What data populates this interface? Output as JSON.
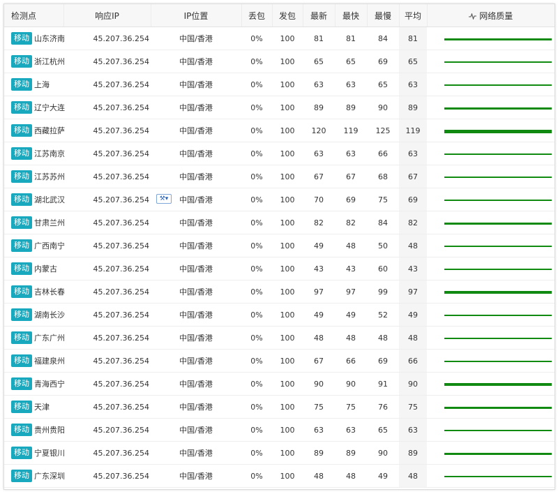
{
  "headers": {
    "node": "检测点",
    "ip": "响应IP",
    "location": "IP位置",
    "loss": "丢包",
    "sent": "发包",
    "latest": "最新",
    "fastest": "最快",
    "slowest": "最慢",
    "avg": "平均",
    "quality": "网络质量"
  },
  "icons": {
    "quality_header": "pulse-icon",
    "tool": "wrench-dropdown-icon"
  },
  "colors": {
    "isp_badge": "#19a9be",
    "quality_line": "#118a11"
  },
  "rows": [
    {
      "isp": "移动",
      "city": "山东济南",
      "ip": "45.207.36.254",
      "location": "中国/香港",
      "loss": "0%",
      "sent": "100",
      "latest": "81",
      "fastest": "81",
      "slowest": "84",
      "avg": "81"
    },
    {
      "isp": "移动",
      "city": "浙江杭州",
      "ip": "45.207.36.254",
      "location": "中国/香港",
      "loss": "0%",
      "sent": "100",
      "latest": "65",
      "fastest": "65",
      "slowest": "69",
      "avg": "65"
    },
    {
      "isp": "移动",
      "city": "上海",
      "ip": "45.207.36.254",
      "location": "中国/香港",
      "loss": "0%",
      "sent": "100",
      "latest": "63",
      "fastest": "63",
      "slowest": "65",
      "avg": "63"
    },
    {
      "isp": "移动",
      "city": "辽宁大连",
      "ip": "45.207.36.254",
      "location": "中国/香港",
      "loss": "0%",
      "sent": "100",
      "latest": "89",
      "fastest": "89",
      "slowest": "90",
      "avg": "89"
    },
    {
      "isp": "移动",
      "city": "西藏拉萨",
      "ip": "45.207.36.254",
      "location": "中国/香港",
      "loss": "0%",
      "sent": "100",
      "latest": "120",
      "fastest": "119",
      "slowest": "125",
      "avg": "119"
    },
    {
      "isp": "移动",
      "city": "江苏南京",
      "ip": "45.207.36.254",
      "location": "中国/香港",
      "loss": "0%",
      "sent": "100",
      "latest": "63",
      "fastest": "63",
      "slowest": "66",
      "avg": "63"
    },
    {
      "isp": "移动",
      "city": "江苏苏州",
      "ip": "45.207.36.254",
      "location": "中国/香港",
      "loss": "0%",
      "sent": "100",
      "latest": "67",
      "fastest": "67",
      "slowest": "68",
      "avg": "67"
    },
    {
      "isp": "移动",
      "city": "湖北武汉",
      "ip": "45.207.36.254",
      "location": "中国/香港",
      "loss": "0%",
      "sent": "100",
      "latest": "70",
      "fastest": "69",
      "slowest": "75",
      "avg": "69"
    },
    {
      "isp": "移动",
      "city": "甘肃兰州",
      "ip": "45.207.36.254",
      "location": "中国/香港",
      "loss": "0%",
      "sent": "100",
      "latest": "82",
      "fastest": "82",
      "slowest": "84",
      "avg": "82"
    },
    {
      "isp": "移动",
      "city": "广西南宁",
      "ip": "45.207.36.254",
      "location": "中国/香港",
      "loss": "0%",
      "sent": "100",
      "latest": "49",
      "fastest": "48",
      "slowest": "50",
      "avg": "48"
    },
    {
      "isp": "移动",
      "city": "内蒙古",
      "ip": "45.207.36.254",
      "location": "中国/香港",
      "loss": "0%",
      "sent": "100",
      "latest": "43",
      "fastest": "43",
      "slowest": "60",
      "avg": "43"
    },
    {
      "isp": "移动",
      "city": "吉林长春",
      "ip": "45.207.36.254",
      "location": "中国/香港",
      "loss": "0%",
      "sent": "100",
      "latest": "97",
      "fastest": "97",
      "slowest": "99",
      "avg": "97"
    },
    {
      "isp": "移动",
      "city": "湖南长沙",
      "ip": "45.207.36.254",
      "location": "中国/香港",
      "loss": "0%",
      "sent": "100",
      "latest": "49",
      "fastest": "49",
      "slowest": "52",
      "avg": "49"
    },
    {
      "isp": "移动",
      "city": "广东广州",
      "ip": "45.207.36.254",
      "location": "中国/香港",
      "loss": "0%",
      "sent": "100",
      "latest": "48",
      "fastest": "48",
      "slowest": "48",
      "avg": "48"
    },
    {
      "isp": "移动",
      "city": "福建泉州",
      "ip": "45.207.36.254",
      "location": "中国/香港",
      "loss": "0%",
      "sent": "100",
      "latest": "67",
      "fastest": "66",
      "slowest": "69",
      "avg": "66"
    },
    {
      "isp": "移动",
      "city": "青海西宁",
      "ip": "45.207.36.254",
      "location": "中国/香港",
      "loss": "0%",
      "sent": "100",
      "latest": "90",
      "fastest": "90",
      "slowest": "91",
      "avg": "90"
    },
    {
      "isp": "移动",
      "city": "天津",
      "ip": "45.207.36.254",
      "location": "中国/香港",
      "loss": "0%",
      "sent": "100",
      "latest": "75",
      "fastest": "75",
      "slowest": "76",
      "avg": "75"
    },
    {
      "isp": "移动",
      "city": "贵州贵阳",
      "ip": "45.207.36.254",
      "location": "中国/香港",
      "loss": "0%",
      "sent": "100",
      "latest": "63",
      "fastest": "63",
      "slowest": "65",
      "avg": "63"
    },
    {
      "isp": "移动",
      "city": "宁夏银川",
      "ip": "45.207.36.254",
      "location": "中国/香港",
      "loss": "0%",
      "sent": "100",
      "latest": "89",
      "fastest": "89",
      "slowest": "90",
      "avg": "89"
    },
    {
      "isp": "移动",
      "city": "广东深圳",
      "ip": "45.207.36.254",
      "location": "中国/香港",
      "loss": "0%",
      "sent": "100",
      "latest": "48",
      "fastest": "48",
      "slowest": "49",
      "avg": "48"
    }
  ]
}
